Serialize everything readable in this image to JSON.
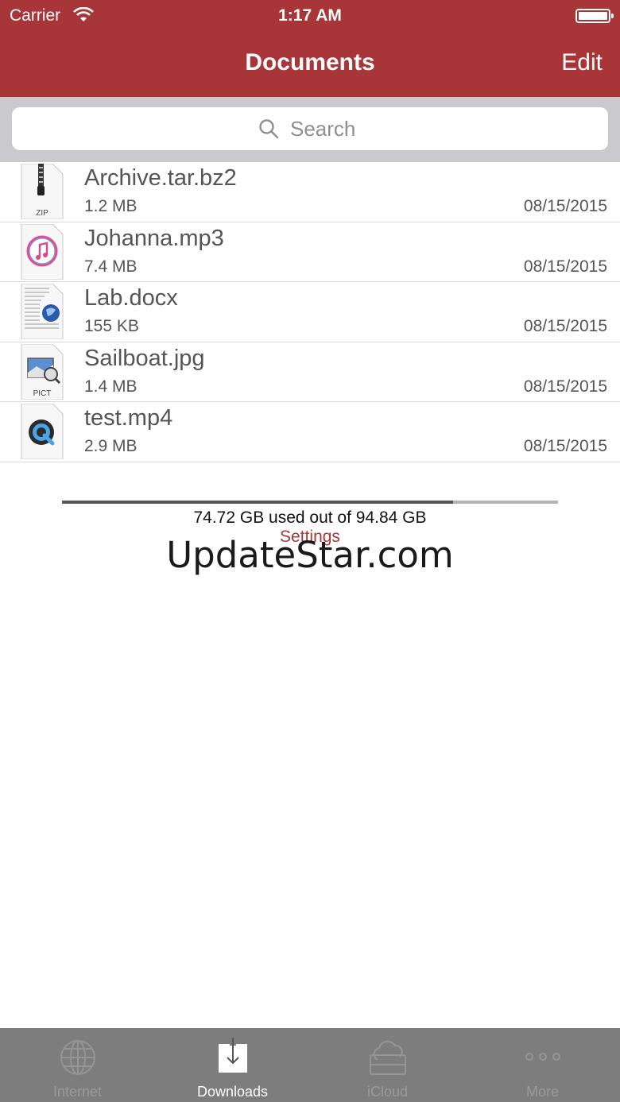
{
  "status_bar": {
    "carrier": "Carrier",
    "time": "1:17 AM"
  },
  "nav": {
    "title": "Documents",
    "edit_label": "Edit"
  },
  "search": {
    "placeholder": "Search"
  },
  "files": [
    {
      "name": "Archive.tar.bz2",
      "size": "1.2 MB",
      "date": "08/15/2015",
      "icon": "zip-icon",
      "badge": "ZIP"
    },
    {
      "name": "Johanna.mp3",
      "size": "7.4 MB",
      "date": "08/15/2015",
      "icon": "music-file-icon"
    },
    {
      "name": "Lab.docx",
      "size": "155 KB",
      "date": "08/15/2015",
      "icon": "document-file-icon"
    },
    {
      "name": "Sailboat.jpg",
      "size": "1.4 MB",
      "date": "08/15/2015",
      "icon": "image-file-icon",
      "badge": "PICT"
    },
    {
      "name": "test.mp4",
      "size": "2.9 MB",
      "date": "08/15/2015",
      "icon": "quicktime-file-icon"
    }
  ],
  "storage": {
    "used_fraction": 0.788,
    "text": "74.72 GB used out of 94.84 GB"
  },
  "settings_label": "Settings",
  "watermark": "UpdateStar.com",
  "tabs": [
    {
      "label": "Internet",
      "icon": "globe-icon",
      "active": false
    },
    {
      "label": "Downloads",
      "icon": "download-icon",
      "active": true
    },
    {
      "label": "iCloud",
      "icon": "cloud-icon",
      "active": false
    },
    {
      "label": "More",
      "icon": "more-icon",
      "active": false
    }
  ],
  "colors": {
    "accent": "#a83538",
    "tab_bar": "#7d7d7d",
    "search_bg": "#c9c9ce"
  }
}
